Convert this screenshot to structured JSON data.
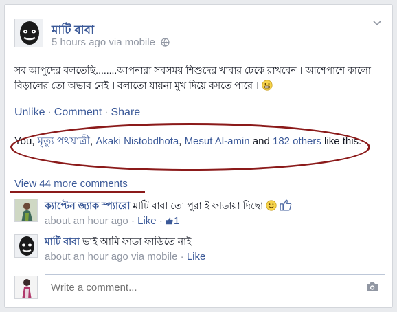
{
  "post": {
    "author": "মাটি বাবা",
    "timestamp": "5 hours ago via mobile",
    "text": "সব আপুদের বলতেছি........আপনারা সবসময় শিশুদের খাবার ঢেকে রাখবেন । আশেপাশে কালো বিড়ালের তো অভাব নেই । বলাতো যায়না মুখ দিয়ে বসতে পারে ।",
    "emoji_icon": "grimace-emoji-icon",
    "menu_icon": "chevron-down-icon",
    "privacy_icon": "globe-icon"
  },
  "actions": {
    "unlike": "Unlike",
    "comment": "Comment",
    "share": "Share",
    "separator": "·"
  },
  "likes": {
    "prefix": "You, ",
    "people": [
      "মৃত্যু পথযাত্রী",
      "Akaki Nistobdhota",
      "Mesut Al-amin"
    ],
    "separator": ", ",
    "conjunction": " and ",
    "others": "182 others",
    "suffix": " like this."
  },
  "view_more": "View 44 more comments",
  "comments": [
    {
      "author": "ক্যাপ্টেন জ্যাক স্প্যারো",
      "text": "মাটি বাবা তো পুরা ই ফাডায়া দিছো",
      "time": "about an hour ago",
      "like_label": "Like",
      "like_count": "1",
      "emoji_icon": "smile-emoji-icon",
      "thumb_icon": "thumbs-up-icon"
    },
    {
      "author": "মাটি বাবা",
      "text": "ভাই আমি ফাডা ফাডিতে নাই",
      "time": "about an hour ago via mobile",
      "like_label": "Like"
    }
  ],
  "composer": {
    "placeholder": "Write a comment...",
    "camera_icon": "camera-icon"
  },
  "colors": {
    "link": "#3b5998",
    "meta": "#9197a3",
    "annotation": "#8b1a1a"
  }
}
